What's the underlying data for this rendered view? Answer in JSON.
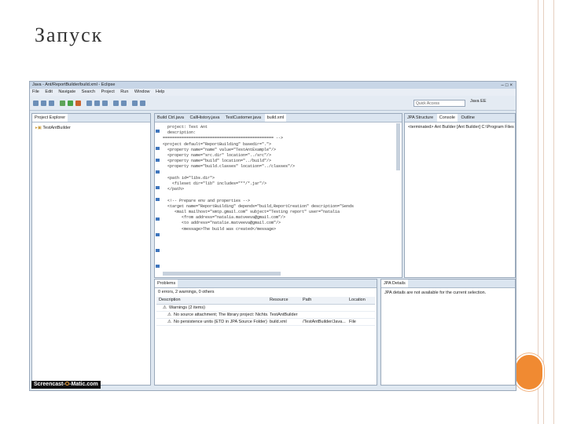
{
  "slide": {
    "title": "Запуск"
  },
  "eclipse": {
    "window_title": "Java - Ant/ReportBuilder/build.xml - Eclipse",
    "menu": [
      "File",
      "Edit",
      "Navigate",
      "Search",
      "Project",
      "Run",
      "Window",
      "Help"
    ],
    "quick_access": "Quick Access",
    "perspective": "Java EE",
    "project_explorer": {
      "tab": "Project Explorer",
      "item": "TestAntBuilder"
    },
    "editor": {
      "tabs": [
        "Build Ctrl.java",
        "CallHistory.java",
        "TestCustomer.java",
        "build.xml"
      ],
      "code_lines": [
        "  project: Test Ant",
        "  description:",
        "=============================================== -->",
        "<project default=\"ReportBuilding\" basedir=\".\">",
        "  <property name=\"name\" value=\"TestAntExample\"/>",
        "  <property name=\"src.dir\" location=\"../src\"/>",
        "  <property name=\"build\" location=\"../build\"/>",
        "  <property name=\"build.classes\" location=\"../classes\"/>",
        "",
        "  <path id=\"libs.dir\">",
        "    <fileset dir=\"lib\" includes=\"**/*.jar\"/>",
        "  </path>",
        "",
        "  <!-- Prepare env and properties -->",
        "  <target name=\"ReportBuilding\" depends=\"build,ReportCreation\" description=\"Sends",
        "     <mail mailhost=\"smtp.gmail.com\" subject=\"Testing report\" user=\"natalia",
        "        <from address=\"natalia.matveeva@gmail.com\"/>",
        "        <to address=\"natalie.matveeva@gmail.com\"/>",
        "        <message>The build was created</message>"
      ]
    },
    "outline": {
      "tabs": [
        "JPA Structure",
        "Console",
        "Outline"
      ],
      "text": "<terminated> Ant Builder [Ant Builder] C:\\Program Files"
    },
    "problems": {
      "tab": "Problems",
      "summary": "0 errors, 2 warnings, 0 others",
      "columns": [
        "Description",
        "Resource",
        "Path",
        "Location"
      ],
      "rows": [
        {
          "description": "Warnings (2 items)",
          "resource": "",
          "path": "",
          "location": ""
        },
        {
          "description": "No source attachment; The library project: Nichts...",
          "resource": "TestAntBuilder",
          "path": "",
          "location": ""
        },
        {
          "description": "No persistence units (ETD in JPA Source Folder)",
          "resource": "build.xml",
          "path": "/TestAntBuilder/Java...",
          "location": "File"
        }
      ]
    },
    "jpa_details": {
      "tab": "JPA Details",
      "text": "JPA details are not available for the current selection."
    },
    "watermark": {
      "prefix": "Screencast-",
      "mid": "O",
      "suffix": "-Matic.com"
    }
  }
}
